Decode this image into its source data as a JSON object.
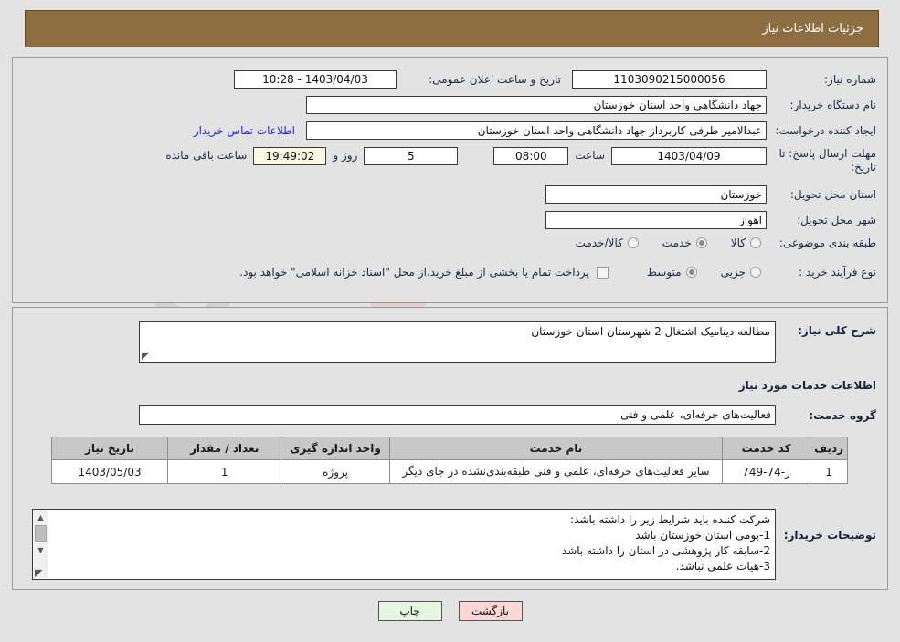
{
  "header": {
    "title": "جزئیات اطلاعات نیاز"
  },
  "top": {
    "need_number_label": "شماره نیاز:",
    "need_number_value": "1103090215000056",
    "announce_label": "تاریخ و ساعت اعلان عمومی:",
    "announce_value": "1403/04/03 - 10:28",
    "buyer_org_label": "نام دستگاه خریدار:",
    "buyer_org_value": "جهاد دانشگاهی واحد استان خوزستان",
    "creator_label": "ایجاد کننده درخواست:",
    "creator_value": "عبدالامیر طرفی کاربرداز جهاد دانشگاهی واحد استان خوزستان",
    "contact_link": "اطلاعات تماس خریدار",
    "deadline_label": "مهلت ارسال پاسخ: تا تاریخ:",
    "deadline_date": "1403/04/09",
    "hour_label": "ساعت",
    "hour_value": "08:00",
    "days_value": "5",
    "days_label": "روز و",
    "countdown_value": "19:49:02",
    "remaining_label": "ساعت باقی مانده",
    "province_label": "استان محل تحویل:",
    "province_value": "خوزستان",
    "city_label": "شهر محل تحویل:",
    "city_value": "اهواز",
    "category_label": "طبقه بندی موضوعی:",
    "category_options": [
      {
        "label": "کالا",
        "selected": false
      },
      {
        "label": "خدمت",
        "selected": true
      },
      {
        "label": "کالا/خدمت",
        "selected": false
      }
    ],
    "process_label": "نوع فرآیند خرید :",
    "process_options": [
      {
        "label": "جزیی",
        "selected": false
      },
      {
        "label": "متوسط",
        "selected": true
      }
    ],
    "treasury_checked": false,
    "treasury_note": "پرداخت تمام یا بخشی از مبلغ خرید،از محل \"اسناد خزانه اسلامی\" خواهد بود."
  },
  "middle": {
    "summary_label": "شرح کلی نیاز:",
    "summary_value": "مطالعه دینامیک اشتغال 2 شهرستان استان خوزستان",
    "section_title": "اطلاعات خدمات مورد نیاز",
    "service_group_label": "گروه خدمت:",
    "service_group_value": "فعالیت‌های حرفه‌ای، علمی و فنی",
    "table": {
      "headers": [
        "ردیف",
        "کد خدمت",
        "نام خدمت",
        "واحد اندازه گیری",
        "تعداد / مقدار",
        "تاریخ نیاز"
      ],
      "rows": [
        {
          "row": "1",
          "code": "ز-74-749",
          "name": "سایر فعالیت‌های حرفه‌ای، علمی و فنی طبقه‌بندی‌نشده در جای دیگر",
          "unit": "پروژه",
          "qty": "1",
          "date": "1403/05/03"
        }
      ]
    },
    "notes_label": "توضیحات خریدار:",
    "notes_value": "شرکت کننده باید شرایط زیر را داشته باشد:\n1-بومی استان خوزستان باشد\n2-سابقه کار پژوهشی در استان را داشته باشد\n3-هیات علمی نباشد."
  },
  "footer": {
    "back_label": "بازگشت",
    "print_label": "چاپ"
  },
  "watermark": {
    "text_left": "Anal",
    "text_right": "Tender.net"
  },
  "colors": {
    "header_brown": "#8d6e43",
    "link_blue": "#2222dd",
    "back_pink": "#fbd7d7",
    "print_green": "#e6f6e2",
    "countdown_cream": "#fbf9e4"
  }
}
